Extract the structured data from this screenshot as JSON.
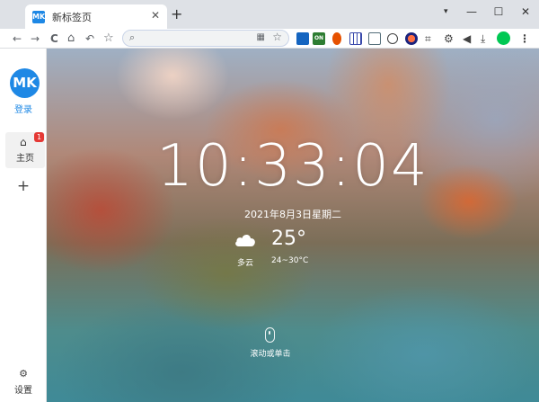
{
  "tab": {
    "title": "新标签页",
    "favicon_text": "MK",
    "close": "✕"
  },
  "newtab": "+",
  "window_controls": {
    "dropdown": "▾",
    "minimize": "—",
    "maximize": "☐",
    "close": "✕"
  },
  "toolbar": {
    "back": "←",
    "forward": "→",
    "reload": "C",
    "home": "⌂",
    "undo": "↶",
    "bookmark": "☆",
    "omnibox": {
      "placeholder": "",
      "search_icon": "⌕",
      "qr_icon": "▦",
      "star_icon": "☆"
    },
    "menu": "⋮",
    "extensions": [
      {
        "icon": "mail-icon",
        "color": "#1565c0"
      },
      {
        "icon": "on-toggle-icon",
        "color": "#2e7d32",
        "text": "ON"
      },
      {
        "icon": "fox-icon",
        "color": "#e65100"
      },
      {
        "icon": "grid-icon",
        "color": "#3949ab"
      },
      {
        "icon": "calendar-icon",
        "color": "#546e7a"
      },
      {
        "icon": "speed-icon",
        "color": "#424242"
      },
      {
        "icon": "avatar-ext-icon",
        "color": "#c62828"
      },
      {
        "icon": "crop-icon",
        "color": "#424242"
      },
      {
        "icon": "settings-ext-icon",
        "color": "#424242"
      },
      {
        "icon": "volume-icon",
        "color": "#424242"
      },
      {
        "icon": "download-icon",
        "color": "#424242"
      },
      {
        "icon": "profile-icon",
        "color": "#00c853"
      }
    ]
  },
  "sidebar": {
    "logo_text": "MK",
    "login": "登录",
    "home_label": "主页",
    "home_icon": "⌂",
    "badge": "1",
    "add": "+",
    "settings_icon": "⚙",
    "settings_label": "设置"
  },
  "main": {
    "time": "10:33:04",
    "date": "2021年8月3日星期二",
    "weather": {
      "temp": "25°",
      "desc": "多云",
      "range": "24~30°C"
    },
    "scroll_hint": "滚动或单击"
  }
}
